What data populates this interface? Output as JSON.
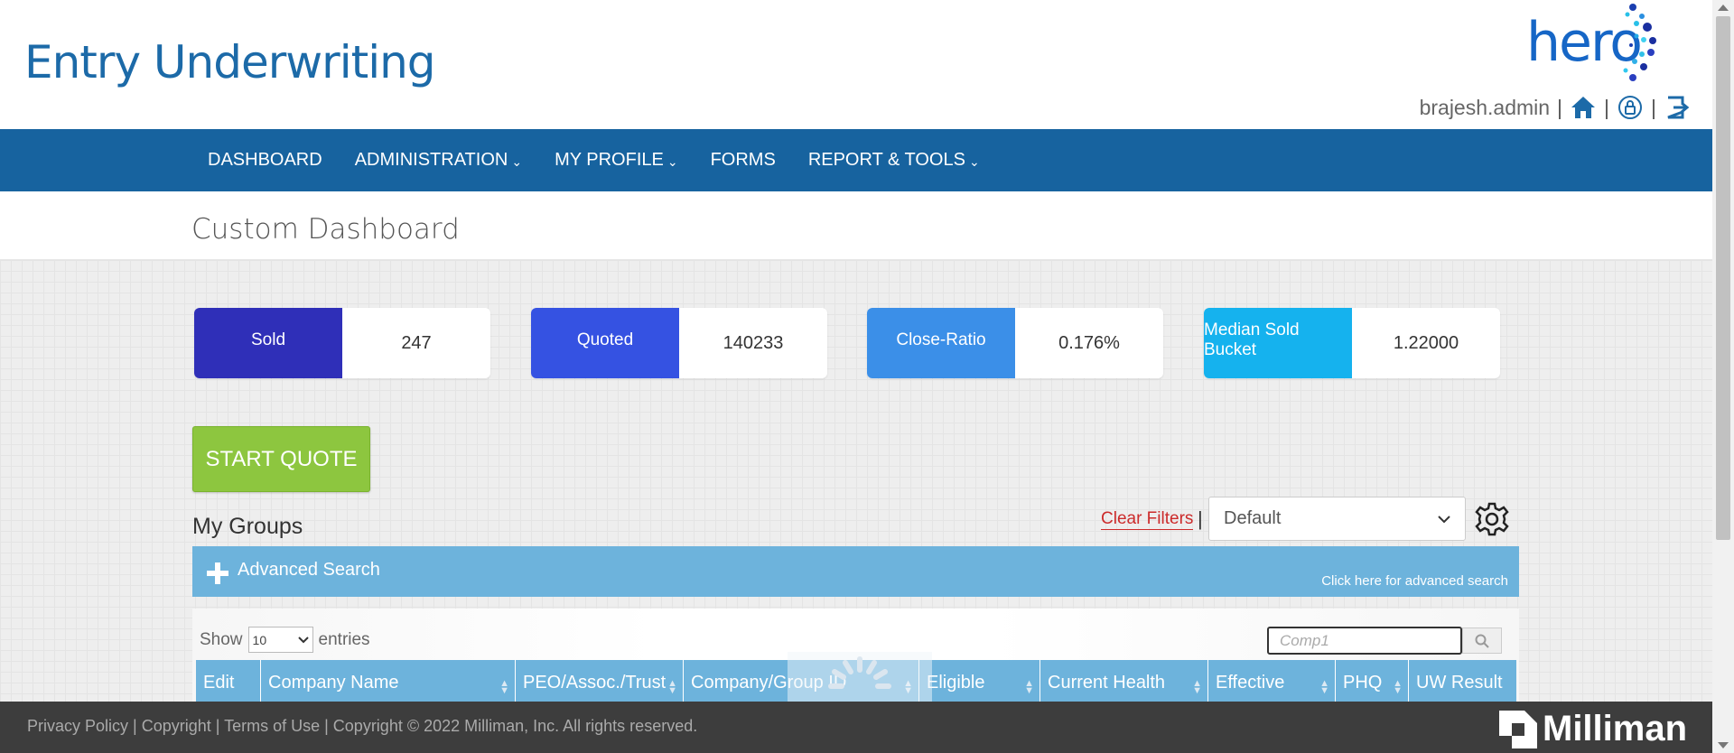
{
  "app": {
    "title": "Entry Underwriting",
    "logo_text": "hero"
  },
  "user": {
    "name": "brajesh.admin",
    "separator": "|"
  },
  "nav": {
    "items": [
      {
        "label": "DASHBOARD",
        "chevron": ""
      },
      {
        "label": "ADMINISTRATION",
        "chevron": "⌄"
      },
      {
        "label": "MY PROFILE",
        "chevron": "⌄"
      },
      {
        "label": "FORMS",
        "chevron": ""
      },
      {
        "label": "REPORT & TOOLS",
        "chevron": "⌄"
      }
    ]
  },
  "page": {
    "title": "Custom Dashboard"
  },
  "kpis": [
    {
      "label": "Sold",
      "value": "247",
      "color": "#2f2fb8"
    },
    {
      "label": "Quoted",
      "value": "140233",
      "color": "#3552e2"
    },
    {
      "label": "Close-Ratio",
      "value": "0.176%",
      "color": "#3b8fe8"
    },
    {
      "label": "Median Sold Bucket",
      "value": "1.22000",
      "color": "#15b2ee"
    }
  ],
  "start_quote": {
    "label": "START QUOTE"
  },
  "groups": {
    "title": "My Groups",
    "clear_filters": "Clear Filters",
    "separator": "|",
    "view_selected": "Default",
    "advanced_search": {
      "label": "Advanced Search",
      "hint": "Click here for advanced search"
    },
    "show_label": "Show",
    "entries_label": "entries",
    "page_length": "10",
    "search_value": "Comp1",
    "columns": [
      {
        "label": "Edit",
        "sortable": false
      },
      {
        "label": "Company Name",
        "sortable": true
      },
      {
        "label": "PEO/Assoc./Trust",
        "sortable": true
      },
      {
        "label": "Company/Group ID",
        "sortable": true
      },
      {
        "label": "Eligible",
        "sortable": true
      },
      {
        "label": "Current Health",
        "sortable": true
      },
      {
        "label": "Effective",
        "sortable": true
      },
      {
        "label": "PHQ",
        "sortable": true
      },
      {
        "label": "UW Result",
        "sortable": false
      }
    ]
  },
  "footer": {
    "links": "Privacy Policy | Copyright | Terms of Use | Copyright © 2022 Milliman, Inc. All rights reserved.",
    "brand": "Milliman"
  },
  "colors": {
    "nav_bg": "#17639f",
    "accent": "#6db3dc",
    "start_quote": "#8dc63f",
    "title_blue": "#1c6aa8"
  },
  "icons": [
    "home-icon",
    "lock-icon",
    "logout-icon",
    "gear-icon",
    "plus-icon",
    "search-icon",
    "chevron-down-icon",
    "sort-icon"
  ]
}
